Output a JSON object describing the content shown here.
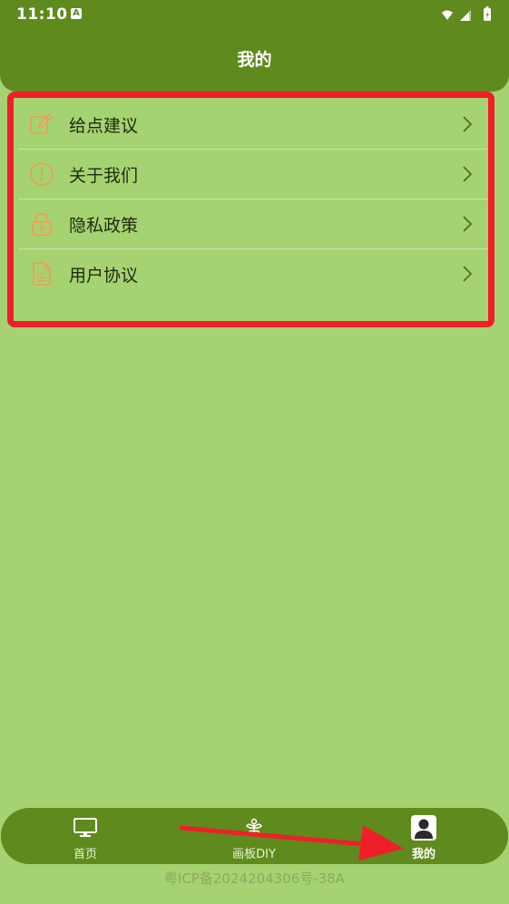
{
  "status_bar": {
    "time": "11:10",
    "badge": "A"
  },
  "header": {
    "title": "我的"
  },
  "menu": {
    "items": [
      {
        "label": "给点建议",
        "icon": "edit-icon"
      },
      {
        "label": "关于我们",
        "icon": "info-icon"
      },
      {
        "label": "隐私政策",
        "icon": "lock-icon"
      },
      {
        "label": "用户协议",
        "icon": "document-icon"
      }
    ]
  },
  "tabs": [
    {
      "label": "首页",
      "icon": "monitor-icon",
      "active": false
    },
    {
      "label": "画板DIY",
      "icon": "flower-icon",
      "active": false
    },
    {
      "label": "我的",
      "icon": "user-icon",
      "active": true
    }
  ],
  "footer": {
    "icp": "粤ICP备2024204306号-38A"
  },
  "colors": {
    "background": "#a6d372",
    "header": "#5f8a1e",
    "icon_accent": "#e8a25a",
    "annotation": "#ef1f2a"
  }
}
